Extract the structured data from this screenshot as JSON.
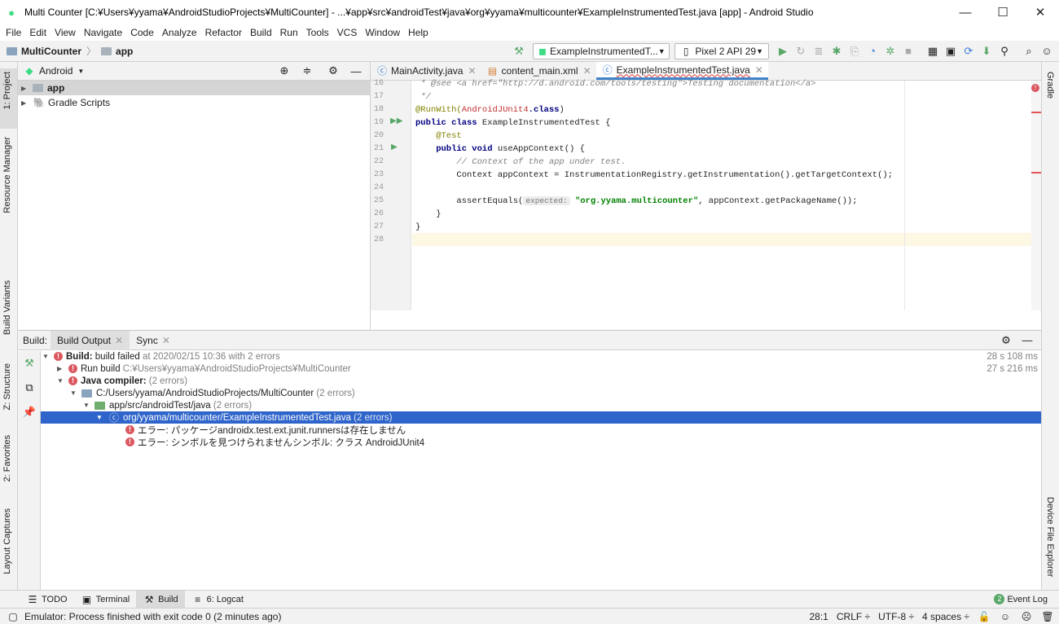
{
  "window": {
    "title": "Multi Counter [C:¥Users¥yyama¥AndroidStudioProjects¥MultiCounter] - ...¥app¥src¥androidTest¥java¥org¥yyama¥multicounter¥ExampleInstrumentedTest.java [app] - Android Studio"
  },
  "menu": [
    "File",
    "Edit",
    "View",
    "Navigate",
    "Code",
    "Analyze",
    "Refactor",
    "Build",
    "Run",
    "Tools",
    "VCS",
    "Window",
    "Help"
  ],
  "nav": {
    "project": "MultiCounter",
    "module": "app",
    "run_config": "ExampleInstrumentedT...",
    "device": "Pixel 2 API 29"
  },
  "left_strip": {
    "project": "1: Project",
    "resource_manager": "Resource Manager",
    "build_variants": "Build Variants",
    "structure": "Z: Structure",
    "favorites": "2: Favorites",
    "layout_captures": "Layout Captures"
  },
  "right_strip": {
    "gradle": "Gradle",
    "device_file_explorer": "Device File Explorer"
  },
  "project_panel": {
    "view": "Android",
    "items": [
      {
        "label": "app"
      },
      {
        "label": "Gradle Scripts"
      }
    ]
  },
  "editor": {
    "tabs": [
      {
        "label": "MainActivity.java"
      },
      {
        "label": "content_main.xml"
      },
      {
        "label": "ExampleInstrumentedTest.java"
      }
    ],
    "lines": [
      "16",
      "17",
      "18",
      "19",
      "20",
      "21",
      "22",
      "23",
      "24",
      "25",
      "26",
      "27",
      "28"
    ],
    "code": {
      "l16": " * @see <a href=\"http://d.android.com/tools/testing\">Testing documentation</a>",
      "l17": " */",
      "l18_a": "@RunWith(",
      "l18_b": "AndroidJUnit4",
      "l18_c": ".class",
      ")": ")",
      "l19_kw": "public class",
      "l19_rest": " ExampleInstrumentedTest {",
      "l20": "    @Test",
      "l21_kw": "    public void",
      "l21_rest": " useAppContext() {",
      "l22": "        // Context of the app under test.",
      "l23": "        Context appContext = InstrumentationRegistry.getInstrumentation().getTargetContext();",
      "l25_a": "        assertEquals(",
      "l25_hint": "expected:",
      "l25_str": "\"org.yyama.multicounter\"",
      "l25_rest": ", appContext.getPackageName());",
      "l26": "    }",
      "l27": "}"
    }
  },
  "build_panel": {
    "label": "Build:",
    "tabs": [
      "Build Output",
      "Sync"
    ],
    "rows": [
      {
        "bold": "Build:",
        "text": "build failed",
        "gray": "at 2020/02/15 10:36  with 2 errors",
        "time": "28 s 108 ms"
      },
      {
        "text": "Run build",
        "gray": "C:¥Users¥yyama¥AndroidStudioProjects¥MultiCounter",
        "time": "27 s 216 ms"
      },
      {
        "bold": "Java compiler:",
        "gray": "(2 errors)"
      },
      {
        "text": "C:/Users/yyama/AndroidStudioProjects/MultiCounter",
        "gray": "(2 errors)"
      },
      {
        "text": "app/src/androidTest/java",
        "gray": "(2 errors)"
      },
      {
        "text": "org/yyama/multicounter/ExampleInstrumentedTest.java",
        "gray": "(2 errors)"
      },
      {
        "text": "エラー: パッケージandroidx.test.ext.junit.runnersは存在しません"
      },
      {
        "text": "エラー: シンボルを見つけられませんシンボル: クラス AndroidJUnit4"
      }
    ]
  },
  "bottom_tabs": [
    {
      "label": "TODO"
    },
    {
      "label": "Terminal"
    },
    {
      "label": "Build"
    },
    {
      "label": "6: Logcat"
    }
  ],
  "event_log": {
    "count": "2",
    "label": "Event Log"
  },
  "status": {
    "message": "Emulator: Process finished with exit code 0 (2 minutes ago)",
    "position": "28:1",
    "line_sep": "CRLF ÷",
    "encoding": "UTF-8 ÷",
    "indent": "4 spaces ÷"
  }
}
